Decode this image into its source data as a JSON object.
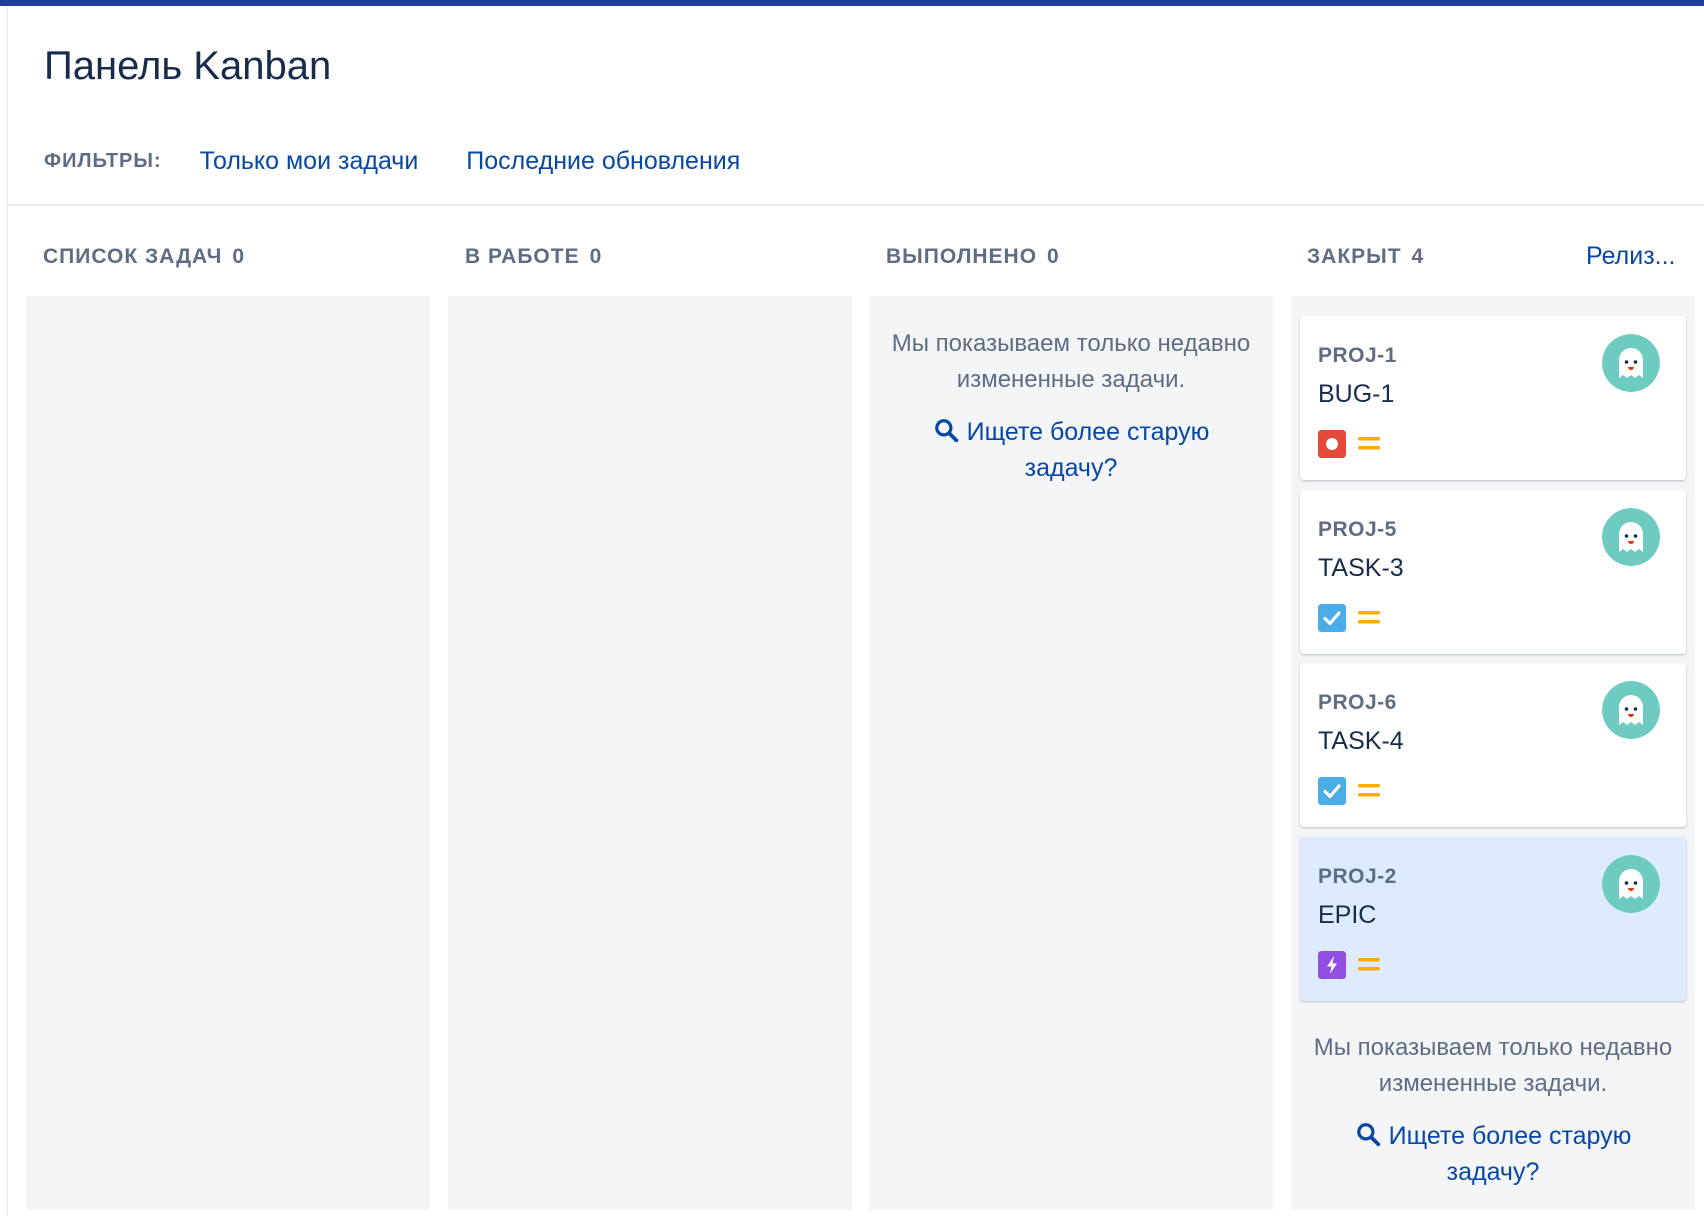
{
  "page": {
    "title": "Панель Kanban"
  },
  "filters": {
    "label": "ФИЛЬТРЫ:",
    "items": [
      "Только мои задачи",
      "Последние обновления"
    ]
  },
  "columns": [
    {
      "name": "СПИСОК ЗАДАЧ",
      "count": "0"
    },
    {
      "name": "В РАБОТЕ",
      "count": "0"
    },
    {
      "name": "ВЫПОЛНЕНО",
      "count": "0"
    },
    {
      "name": "ЗАКРЫТ",
      "count": "4"
    }
  ],
  "release_link": "Релиз...",
  "empty_notice": {
    "text": "Мы показываем только недавно измененные задачи.",
    "link": "Ищете более старую задачу?"
  },
  "cards": [
    {
      "key": "PROJ-1",
      "summary": "BUG-1",
      "type_icon": "bug-icon",
      "priority_icon": "priority-medium-icon",
      "selected": false
    },
    {
      "key": "PROJ-5",
      "summary": "TASK-3",
      "type_icon": "task-icon",
      "priority_icon": "priority-medium-icon",
      "selected": false
    },
    {
      "key": "PROJ-6",
      "summary": "TASK-4",
      "type_icon": "task-icon",
      "priority_icon": "priority-medium-icon",
      "selected": false
    },
    {
      "key": "PROJ-2",
      "summary": "EPIC",
      "type_icon": "epic-icon",
      "priority_icon": "priority-medium-icon",
      "selected": true
    }
  ],
  "colors": {
    "accent": "#0747a6",
    "top_bar": "#1d3f99",
    "bug": "#e5493a",
    "task": "#4bade8",
    "epic": "#904ee2",
    "priority_medium": "#ffab00",
    "avatar": "#6dcbc2",
    "selected_card": "#deebff"
  }
}
